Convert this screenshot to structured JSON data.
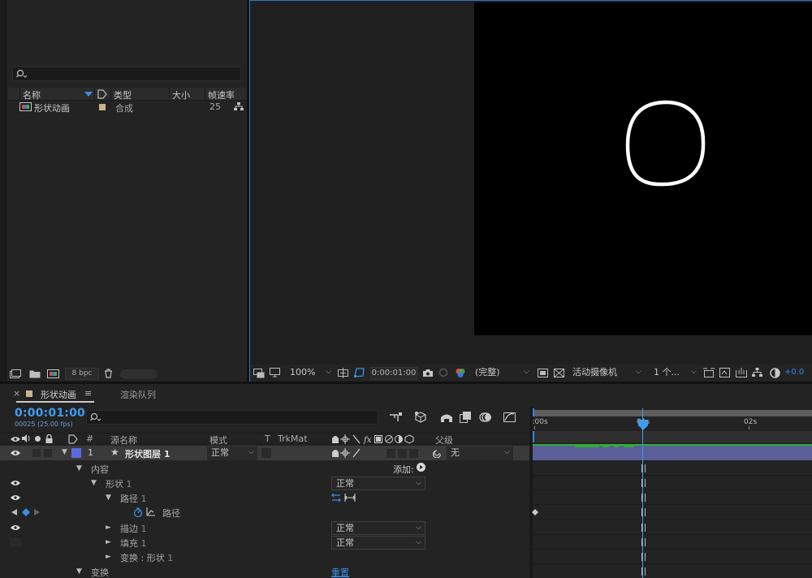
{
  "project": {
    "search_placeholder": "",
    "columns": {
      "name": "名称",
      "type": "类型",
      "size": "大小",
      "fps": "帧速率"
    },
    "items": [
      {
        "name": "形状动画",
        "type": "合成",
        "size": "",
        "fps": "25"
      }
    ],
    "bpc": "8 bpc"
  },
  "viewer": {
    "zoom": "100%",
    "timecode": "0:00:01:00",
    "resolution": "(完整)",
    "camera": "活动摄像机",
    "views": "1 个...",
    "exposure": "+0.0"
  },
  "timeline": {
    "tabs": [
      {
        "label": "形状动画",
        "active": true
      },
      {
        "label": "渲染队列",
        "active": false
      }
    ],
    "current_time": "0:00:01:00",
    "frame_info": "00025 (25.00 fps)",
    "search_placeholder": "",
    "columns": {
      "hash": "#",
      "source": "源名称",
      "mode": "模式",
      "t": "T",
      "trkmat": "TrkMat",
      "parent": "父级"
    },
    "ruler": {
      "start": "):00s",
      "mid": "01s",
      "end": "02s"
    },
    "layer": {
      "index": "1",
      "name": "形状图层 1",
      "mode": "正常",
      "parent": "无"
    },
    "tree": {
      "contents": "内容",
      "add": "添加:",
      "shape": "形状",
      "shape_num": "1",
      "shape_mode": "正常",
      "path_group": "路径",
      "path_group_num": "1",
      "path": "路径",
      "stroke": "描边",
      "stroke_num": "1",
      "stroke_mode": "正常",
      "fill": "填充",
      "fill_num": "1",
      "fill_mode": "正常",
      "transform_shape": "变换 : 形状",
      "transform_shape_num": "1",
      "transform": "变换",
      "reset": "重置"
    },
    "playhead_fraction": 0.5,
    "accent": "#2d8ceb",
    "layer_bar_color": "#5a5f99"
  }
}
